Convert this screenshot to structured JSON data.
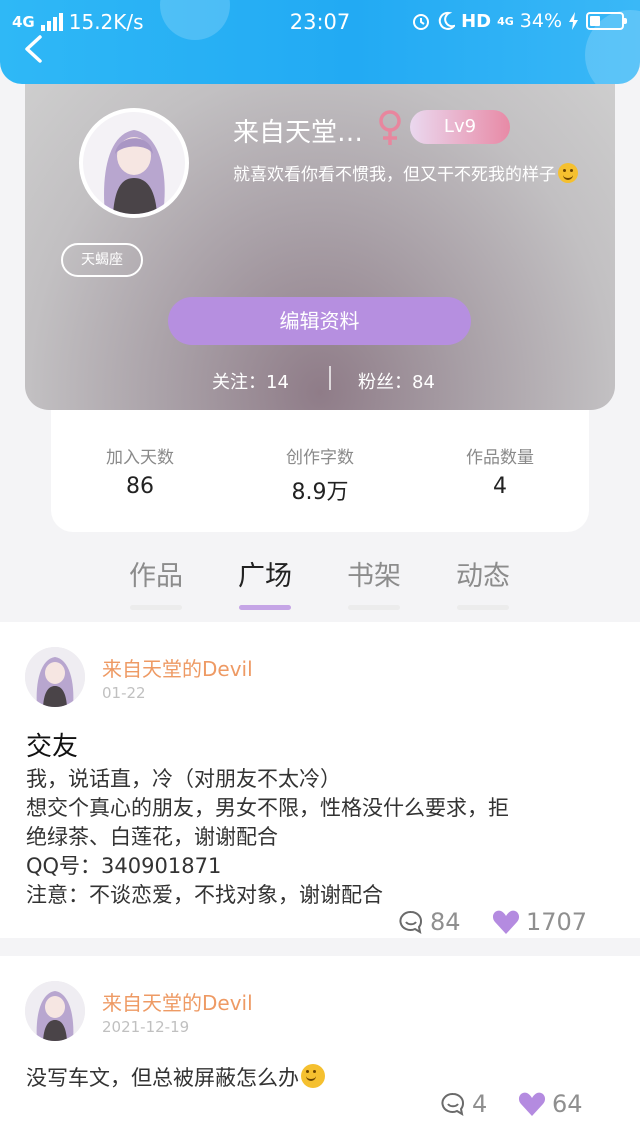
{
  "status_bar": {
    "network": "4G",
    "speed": "15.2K/s",
    "time": "23:07",
    "hd": "HD",
    "net_right": "4G",
    "battery": "34%",
    "battery_level": 0.34
  },
  "profile": {
    "nickname": "来自天堂…",
    "level": "Lv9",
    "bio": "就喜欢看你看不惯我，但又干不死我的样子",
    "zodiac": "天蝎座",
    "edit_label": "编辑资料",
    "following": "关注：14",
    "followers": "粉丝：84"
  },
  "stats": [
    {
      "label": "加入天数",
      "value": "86"
    },
    {
      "label": "创作字数",
      "value": "8.9万"
    },
    {
      "label": "作品数量",
      "value": "4"
    }
  ],
  "tabs": [
    {
      "label": "作品",
      "active": false
    },
    {
      "label": "广场",
      "active": true
    },
    {
      "label": "书架",
      "active": false
    },
    {
      "label": "动态",
      "active": false
    }
  ],
  "posts": [
    {
      "author": "来自天堂的Devil",
      "date": "01-22",
      "title": "交友",
      "lines": [
        "我，说话直，冷（对朋友不太冷）",
        "想交个真心的朋友，男女不限，性格没什么要求，拒",
        "绝绿茶、白莲花，谢谢配合",
        "QQ号：340901871",
        "注意：不谈恋爱，不找对象，谢谢配合"
      ],
      "comments": "84",
      "likes": "1707"
    },
    {
      "author": "来自天堂的Devil",
      "date": "2021-12-19",
      "title": "",
      "lines": [
        "没写车文，但总被屏蔽怎么办"
      ],
      "comments": "4",
      "likes": "64"
    }
  ],
  "colors": {
    "accent": "#b68fe0",
    "author": "#ee9a64",
    "topbar": "#22aaf3",
    "like": "#b48be0"
  }
}
